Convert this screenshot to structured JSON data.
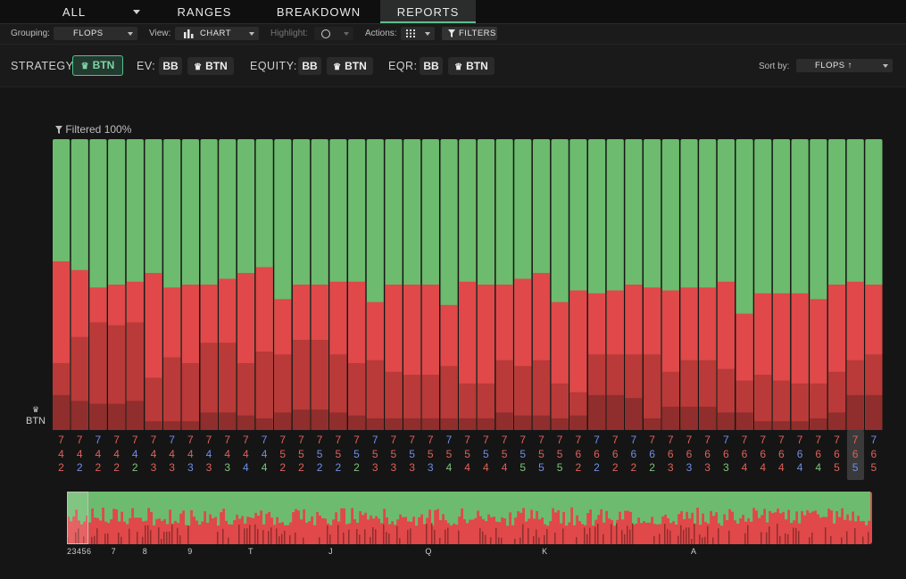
{
  "top_tabs": [
    {
      "label": "ALL"
    },
    {
      "label": "RANGES"
    },
    {
      "label": "BREAKDOWN"
    },
    {
      "label": "REPORTS",
      "active": true
    }
  ],
  "toolbar": {
    "grouping_label": "Grouping:",
    "grouping_value": "FLOPS",
    "view_label": "View:",
    "view_value": "CHART",
    "highlight_label": "Highlight:",
    "actions_label": "Actions:",
    "filters_label": "FILTERS"
  },
  "strategy_row": {
    "strategy_label": "STRATEGY:",
    "strategy_value": "BTN",
    "ev_label": "EV:",
    "equity_label": "EQUITY:",
    "eqr_label": "EQR:",
    "bb": "BB",
    "btn": "BTN",
    "sort_label": "Sort by:",
    "sort_value": "FLOPS ↑"
  },
  "chart": {
    "filter_text": "Filtered  100%",
    "player_label": "BTN"
  },
  "colors": {
    "green": "#6dbb6e",
    "red": "#e0484a",
    "red_dark": "#b93a38",
    "red_darker": "#8f2e2c",
    "rank_red": "#e0605a",
    "rank_blue": "#6f8fe6",
    "rank_green": "#7cc57c",
    "accent": "#4fc38a"
  },
  "chart_data": {
    "type": "bar",
    "stacked": true,
    "x": [
      "742",
      "742",
      "742",
      "742",
      "742",
      "733",
      "733",
      "733",
      "733",
      "734",
      "744",
      "744",
      "752",
      "752",
      "752",
      "752",
      "752",
      "753",
      "753",
      "753",
      "753",
      "754",
      "754",
      "754",
      "754",
      "755",
      "755",
      "755",
      "762",
      "762",
      "762",
      "762",
      "762",
      "763",
      "763",
      "763",
      "763",
      "764",
      "764",
      "764",
      "764",
      "764",
      "765",
      "765",
      "765"
    ],
    "rank1": [
      "7",
      "7",
      "7",
      "7",
      "7",
      "7",
      "7",
      "7",
      "7",
      "7",
      "7",
      "7",
      "7",
      "7",
      "7",
      "7",
      "7",
      "7",
      "7",
      "7",
      "7",
      "7",
      "7",
      "7",
      "7",
      "7",
      "7",
      "7",
      "7",
      "7",
      "7",
      "7",
      "7",
      "7",
      "7",
      "7",
      "7",
      "7",
      "7",
      "7",
      "7",
      "7",
      "7",
      "7",
      "7"
    ],
    "rank1_colors": [
      "r",
      "r",
      "b",
      "r",
      "r",
      "r",
      "b",
      "r",
      "r",
      "r",
      "r",
      "b",
      "r",
      "r",
      "r",
      "r",
      "r",
      "b",
      "r",
      "r",
      "r",
      "b",
      "r",
      "r",
      "r",
      "r",
      "r",
      "r",
      "r",
      "b",
      "r",
      "b",
      "r",
      "r",
      "r",
      "r",
      "b",
      "r",
      "r",
      "r",
      "r",
      "r",
      "r",
      "r",
      "b"
    ],
    "rank2": [
      "4",
      "4",
      "4",
      "4",
      "4",
      "4",
      "4",
      "4",
      "4",
      "4",
      "4",
      "4",
      "5",
      "5",
      "5",
      "5",
      "5",
      "5",
      "5",
      "5",
      "5",
      "5",
      "5",
      "5",
      "5",
      "5",
      "5",
      "5",
      "6",
      "6",
      "6",
      "6",
      "6",
      "6",
      "6",
      "6",
      "6",
      "6",
      "6",
      "6",
      "6",
      "6",
      "6",
      "6",
      "6"
    ],
    "rank2_colors": [
      "r",
      "r",
      "r",
      "r",
      "b",
      "r",
      "r",
      "r",
      "b",
      "r",
      "r",
      "b",
      "r",
      "r",
      "b",
      "r",
      "b",
      "r",
      "r",
      "b",
      "r",
      "r",
      "r",
      "b",
      "r",
      "b",
      "r",
      "r",
      "r",
      "r",
      "r",
      "b",
      "b",
      "r",
      "r",
      "r",
      "r",
      "r",
      "r",
      "r",
      "b",
      "r",
      "r",
      "r",
      "r"
    ],
    "rank3": [
      "2",
      "2",
      "2",
      "2",
      "2",
      "3",
      "3",
      "3",
      "3",
      "3",
      "4",
      "4",
      "2",
      "2",
      "2",
      "2",
      "2",
      "3",
      "3",
      "3",
      "3",
      "4",
      "4",
      "4",
      "4",
      "5",
      "5",
      "5",
      "2",
      "2",
      "2",
      "2",
      "2",
      "3",
      "3",
      "3",
      "3",
      "4",
      "4",
      "4",
      "4",
      "4",
      "5",
      "5",
      "5"
    ],
    "rank3_colors": [
      "r",
      "b",
      "r",
      "r",
      "g",
      "r",
      "r",
      "b",
      "r",
      "g",
      "b",
      "g",
      "r",
      "r",
      "b",
      "b",
      "g",
      "r",
      "r",
      "r",
      "b",
      "g",
      "r",
      "r",
      "r",
      "g",
      "b",
      "g",
      "r",
      "b",
      "r",
      "r",
      "g",
      "r",
      "b",
      "r",
      "g",
      "r",
      "r",
      "r",
      "b",
      "g",
      "r",
      "b",
      "r"
    ],
    "series": [
      {
        "name": "BTN",
        "values": [
          0.58,
          0.55,
          0.49,
          0.5,
          0.51,
          0.54,
          0.49,
          0.5,
          0.5,
          0.52,
          0.54,
          0.56,
          0.45,
          0.5,
          0.5,
          0.51,
          0.51,
          0.44,
          0.5,
          0.5,
          0.5,
          0.43,
          0.51,
          0.5,
          0.5,
          0.52,
          0.54,
          0.44,
          0.48,
          0.47,
          0.48,
          0.5,
          0.49,
          0.48,
          0.49,
          0.49,
          0.51,
          0.4,
          0.47,
          0.47,
          0.47,
          0.45,
          0.5,
          0.51,
          0.5
        ]
      },
      {
        "name": "",
        "values": [
          0.11,
          0.22,
          0.28,
          0.27,
          0.27,
          0.15,
          0.22,
          0.2,
          0.24,
          0.24,
          0.18,
          0.23,
          0.2,
          0.24,
          0.24,
          0.2,
          0.18,
          0.2,
          0.16,
          0.15,
          0.15,
          0.18,
          0.12,
          0.12,
          0.18,
          0.17,
          0.19,
          0.12,
          0.08,
          0.14,
          0.14,
          0.15,
          0.22,
          0.12,
          0.16,
          0.16,
          0.15,
          0.11,
          0.16,
          0.14,
          0.13,
          0.12,
          0.14,
          0.12,
          0.14
        ]
      },
      {
        "name": "",
        "values": [
          0.12,
          0.1,
          0.09,
          0.09,
          0.1,
          0.03,
          0.03,
          0.03,
          0.06,
          0.06,
          0.05,
          0.04,
          0.06,
          0.07,
          0.07,
          0.06,
          0.05,
          0.04,
          0.04,
          0.04,
          0.04,
          0.04,
          0.04,
          0.04,
          0.06,
          0.05,
          0.05,
          0.04,
          0.05,
          0.12,
          0.12,
          0.11,
          0.04,
          0.08,
          0.08,
          0.08,
          0.06,
          0.06,
          0.03,
          0.03,
          0.03,
          0.04,
          0.06,
          0.12,
          0.12
        ]
      }
    ],
    "ylim": [
      0,
      1
    ]
  },
  "minimap": {
    "ticks": [
      {
        "label": "23456",
        "pos": 0.0
      },
      {
        "label": "7",
        "pos": 0.055
      },
      {
        "label": "8",
        "pos": 0.094
      },
      {
        "label": "9",
        "pos": 0.15
      },
      {
        "label": "T",
        "pos": 0.225
      },
      {
        "label": "J",
        "pos": 0.325
      },
      {
        "label": "Q",
        "pos": 0.445
      },
      {
        "label": "K",
        "pos": 0.59
      },
      {
        "label": "A",
        "pos": 0.775
      }
    ]
  }
}
